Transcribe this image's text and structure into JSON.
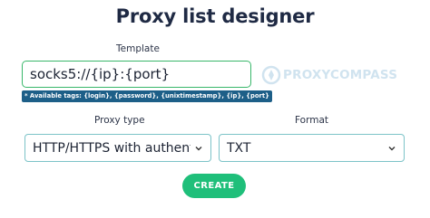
{
  "title": "Proxy list designer",
  "template": {
    "label": "Template",
    "value": "socks5://{ip}:{port}",
    "tags_hint": "* Available tags: {login}, {password}, {unixtimestamp}, {ip}, {port}"
  },
  "logo": {
    "text": "PROXYCOMPASS",
    "icon": "compass-logo-icon"
  },
  "proxy_type": {
    "label": "Proxy type",
    "selected": "HTTP/HTTPS with authent"
  },
  "format": {
    "label": "Format",
    "selected": "TXT"
  },
  "create_button": {
    "label": "CREATE"
  },
  "colors": {
    "accent_green": "#1fbf7a",
    "title": "#1f2a44",
    "tag_badge": "#1d5f88",
    "select_border": "#7cc3c8"
  }
}
